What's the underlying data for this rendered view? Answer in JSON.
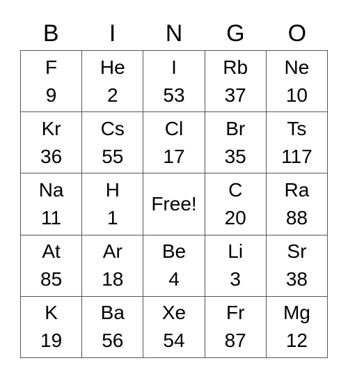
{
  "header": [
    "B",
    "I",
    "N",
    "G",
    "O"
  ],
  "cells": [
    {
      "symbol": "F",
      "number": "9"
    },
    {
      "symbol": "He",
      "number": "2"
    },
    {
      "symbol": "I",
      "number": "53"
    },
    {
      "symbol": "Rb",
      "number": "37"
    },
    {
      "symbol": "Ne",
      "number": "10"
    },
    {
      "symbol": "Kr",
      "number": "36"
    },
    {
      "symbol": "Cs",
      "number": "55"
    },
    {
      "symbol": "Cl",
      "number": "17"
    },
    {
      "symbol": "Br",
      "number": "35"
    },
    {
      "symbol": "Ts",
      "number": "117"
    },
    {
      "symbol": "Na",
      "number": "11"
    },
    {
      "symbol": "H",
      "number": "1"
    },
    {
      "free": "Free!"
    },
    {
      "symbol": "C",
      "number": "20"
    },
    {
      "symbol": "Ra",
      "number": "88"
    },
    {
      "symbol": "At",
      "number": "85"
    },
    {
      "symbol": "Ar",
      "number": "18"
    },
    {
      "symbol": "Be",
      "number": "4"
    },
    {
      "symbol": "Li",
      "number": "3"
    },
    {
      "symbol": "Sr",
      "number": "38"
    },
    {
      "symbol": "K",
      "number": "19"
    },
    {
      "symbol": "Ba",
      "number": "56"
    },
    {
      "symbol": "Xe",
      "number": "54"
    },
    {
      "symbol": "Fr",
      "number": "87"
    },
    {
      "symbol": "Mg",
      "number": "12"
    }
  ]
}
